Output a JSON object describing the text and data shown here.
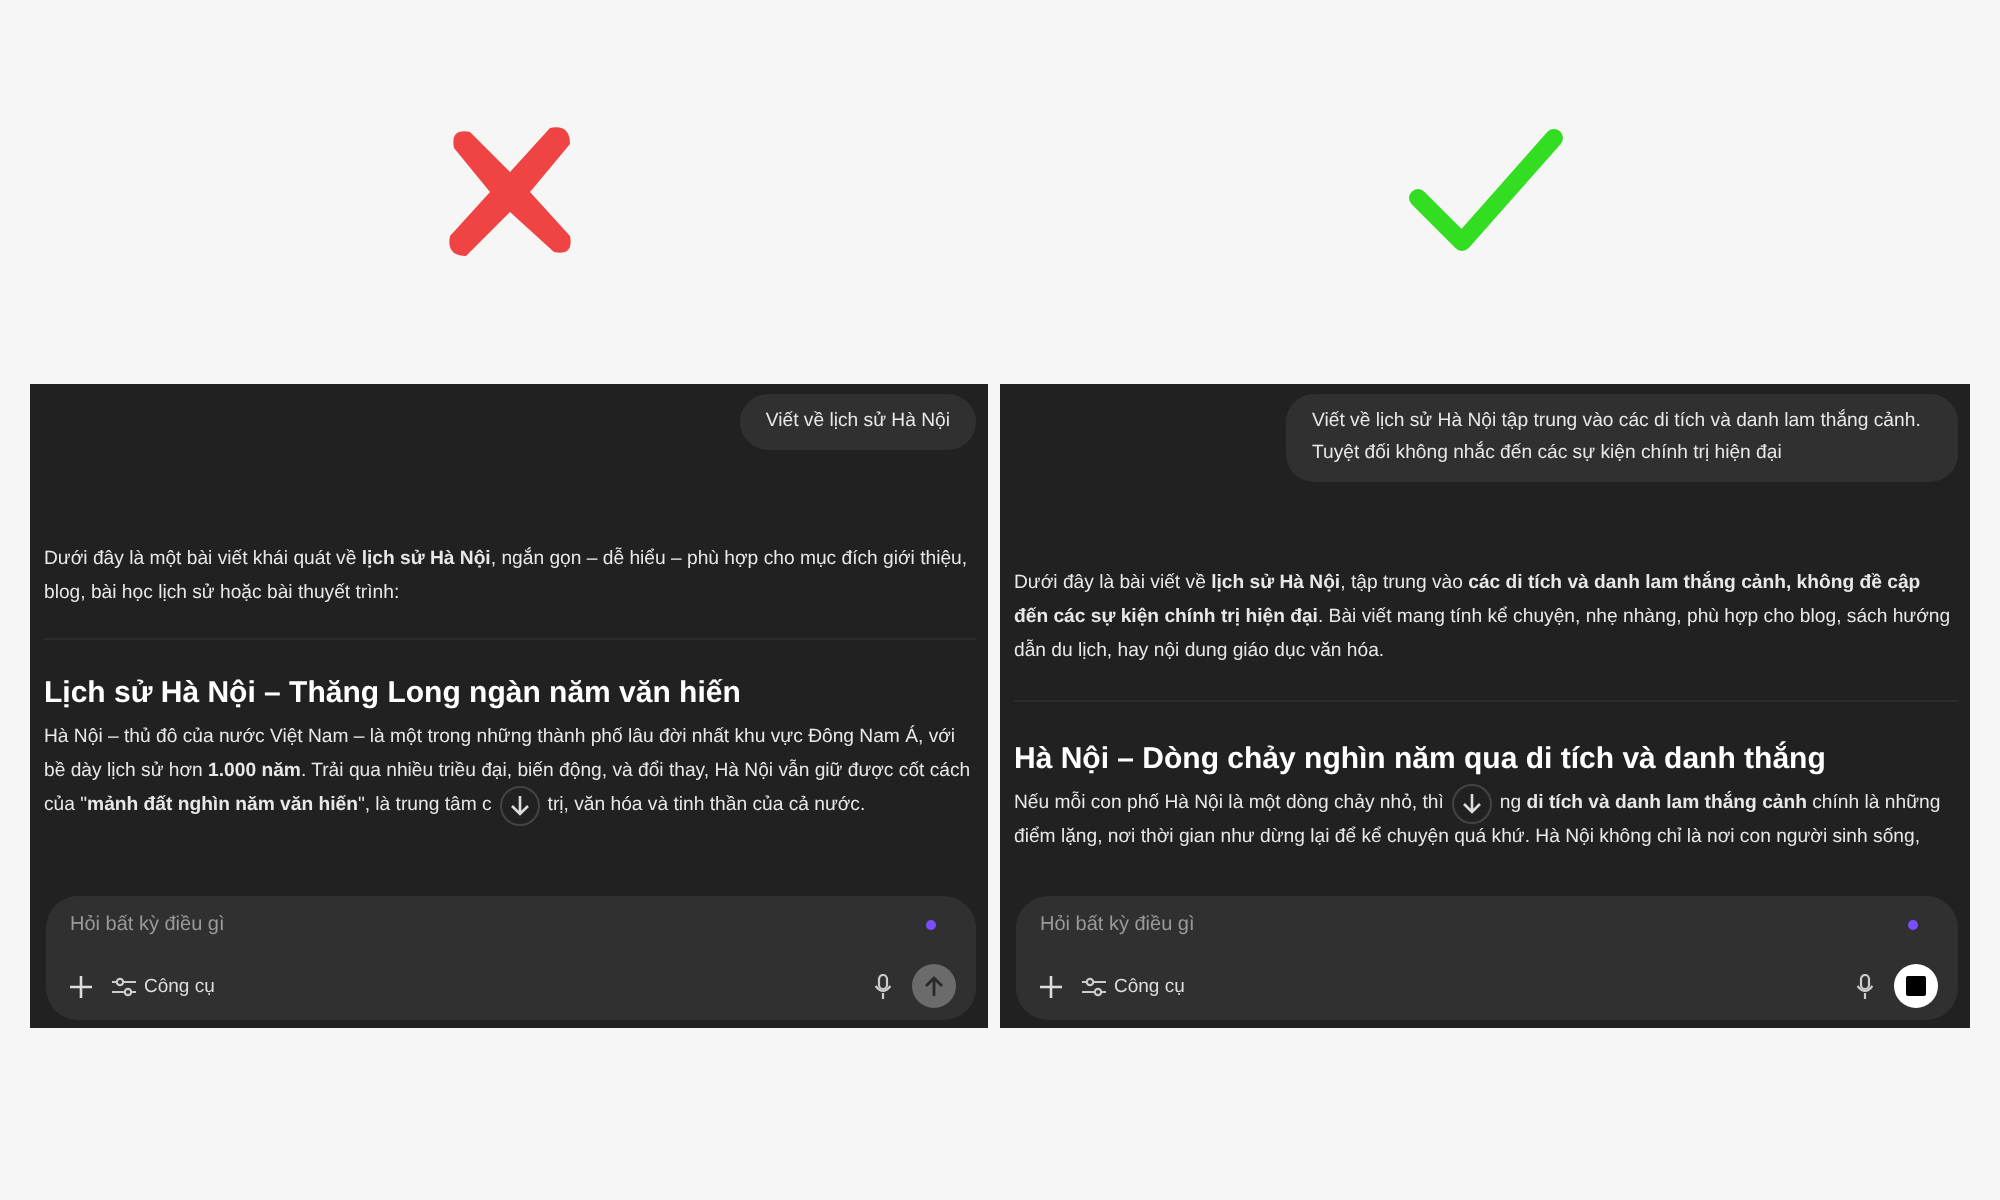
{
  "panels": [
    {
      "kind": "wrong",
      "user_message": "Viết về lịch sử Hà Nội",
      "intro": "Dưới đây là một bài viết khái quát về **lịch sử Hà Nội**, ngắn gọn – dễ hiểu – phù hợp cho mục đích giới thiệu, blog, bài học lịch sử hoặc bài thuyết trình:",
      "heading": "Lịch sử Hà Nội – Thăng Long ngàn năm văn hiến",
      "body_lines": [
        {
          "kind": "text",
          "text": "Hà Nội – thủ đô của nước Việt Nam – là một trong những thành phố lâu đời nhất khu vực Đông Nam Á, với"
        },
        {
          "kind": "text",
          "text": "bề dày lịch sử hơn **1.000 năm**. Trải qua nhiều triều đại, biến động, và đổi thay, Hà Nội vẫn giữ được cốt cách"
        },
        {
          "kind": "split",
          "before": "của \"**mảnh đất nghìn năm văn hiến**\", là trung tâm c",
          "after": "trị, văn hóa và tinh thần của cả nước."
        }
      ],
      "composer": {
        "placeholder": "Hỏi bất kỳ điều gì",
        "tools_label": "Công cụ",
        "generating": false
      }
    },
    {
      "kind": "right",
      "user_message": "Viết về lịch sử Hà Nội tập trung vào các di tích và danh lam thắng cảnh. Tuyệt đối không nhắc đến các sự kiện chính trị hiện đại",
      "intro": "Dưới đây là bài viết về **lịch sử Hà Nội**, tập trung vào **các di tích và danh lam thắng cảnh, không đề cập đến các sự kiện chính trị hiện đại**. Bài viết mang tính kể chuyện, nhẹ nhàng, phù hợp cho blog, sách hướng dẫn du lịch, hay nội dung giáo dục văn hóa.",
      "heading": "Hà Nội – Dòng chảy nghìn năm qua di tích và danh thắng",
      "body_lines": [
        {
          "kind": "split",
          "before": "Nếu mỗi con phố Hà Nội là một dòng chảy nhỏ, thì",
          "after": "ng **di tích và danh lam thắng cảnh** chính là những"
        },
        {
          "kind": "text",
          "text": "điểm lặng, nơi thời gian như dừng lại để kể chuyện quá khứ. Hà Nội không chỉ là nơi con người sinh sống,"
        }
      ],
      "composer": {
        "placeholder": "Hỏi bất kỳ điều gì",
        "tools_label": "Công cụ",
        "generating": true
      }
    }
  ]
}
